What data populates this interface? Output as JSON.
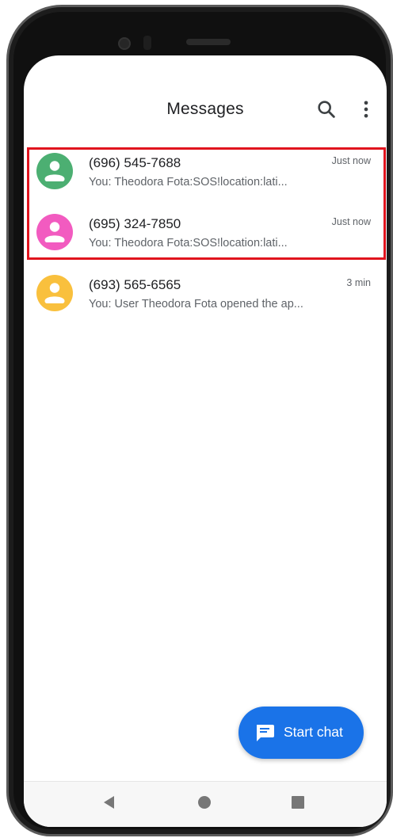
{
  "app_bar": {
    "title": "Messages",
    "search_icon": "search-icon",
    "more_icon": "more-vert-icon"
  },
  "conversations": [
    {
      "name": "(696) 545-7688",
      "snippet": "You: Theodora Fota:SOS!location:lati...",
      "time": "Just now",
      "avatar_color": "#4caf72"
    },
    {
      "name": "(695) 324-7850",
      "snippet": "You: Theodora Fota:SOS!location:lati...",
      "time": "Just now",
      "avatar_color": "#f25bc0"
    },
    {
      "name": "(693) 565-6565",
      "snippet": "You: User Theodora Fota opened the ap...",
      "time": "3 min",
      "avatar_color": "#f9c03d"
    }
  ],
  "fab": {
    "label": "Start chat",
    "icon": "chat-icon",
    "color": "#1a73e8"
  },
  "highlight_color": "#e0141e",
  "nav_bar": {
    "back_icon": "back-icon",
    "home_icon": "home-icon",
    "recents_icon": "recents-icon"
  }
}
